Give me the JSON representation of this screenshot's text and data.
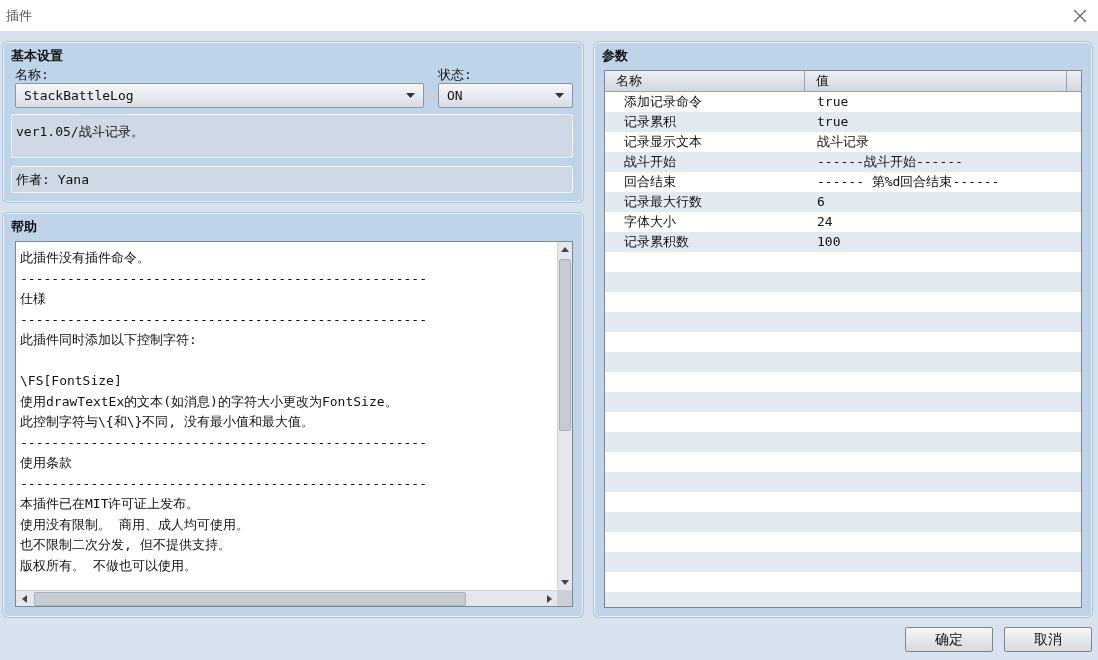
{
  "window": {
    "title": "插件"
  },
  "basic": {
    "title": "基本设置",
    "name_label": "名称:",
    "name_value": "StackBattleLog",
    "status_label": "状态:",
    "status_value": "ON",
    "description": "ver1.05/战斗记录。",
    "author": "作者: Yana"
  },
  "help": {
    "title": "帮助",
    "paragraphs": [
      [
        "此插件没有插件命令。",
        "----------------------------------------------------",
        "仕様",
        "----------------------------------------------------",
        "此插件同时添加以下控制字符:"
      ],
      [
        "\\FS[FontSize]",
        "使用drawTextEx的文本(如消息)的字符大小更改为FontSize。",
        "此控制字符与\\{和\\}不同, 没有最小值和最大值。",
        "----------------------------------------------------",
        "使用条款",
        "----------------------------------------------------",
        "本插件已在MIT许可证上发布。",
        "使用没有限制。 商用、成人均可使用。",
        "也不限制二次分发, 但不提供支持。",
        "版权所有。 不做也可以使用。"
      ]
    ]
  },
  "parameters": {
    "title": "参数",
    "columns": [
      "名称",
      "值"
    ],
    "rows": [
      {
        "name": "添加记录命令",
        "value": "true"
      },
      {
        "name": "记录累积",
        "value": "true"
      },
      {
        "name": "记录显示文本",
        "value": "战斗记录"
      },
      {
        "name": "战斗开始",
        "value": "------战斗开始------"
      },
      {
        "name": "回合结束",
        "value": "------ 第%d回合结束------"
      },
      {
        "name": "记录最大行数",
        "value": "6"
      },
      {
        "name": "字体大小",
        "value": "24"
      },
      {
        "name": "记录累积数",
        "value": "100"
      }
    ]
  },
  "buttons": [
    "确定",
    "取消"
  ]
}
